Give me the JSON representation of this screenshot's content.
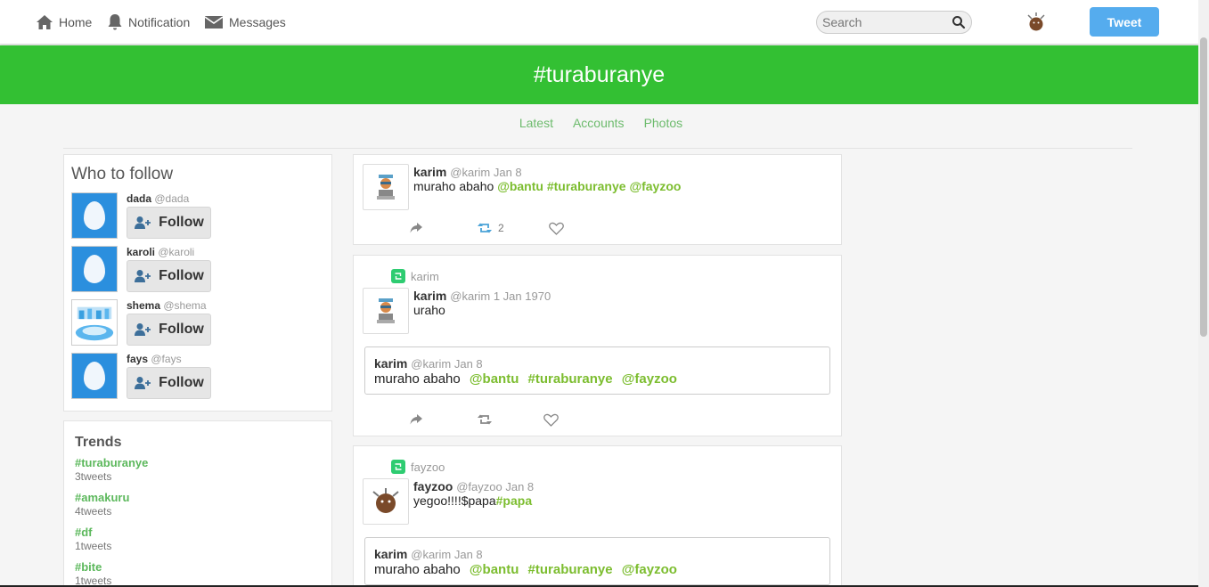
{
  "nav": {
    "home": "Home",
    "notification": "Notification",
    "messages": "Messages",
    "search_placeholder": "Search",
    "tweet_button": "Tweet"
  },
  "banner": {
    "hashtag": "#turaburanye"
  },
  "tabs": [
    "Latest",
    "Accounts",
    "Photos"
  ],
  "who_to_follow": {
    "title": "Who to follow",
    "follow_label": "Follow",
    "users": [
      {
        "name": "dada",
        "handle": "@dada"
      },
      {
        "name": "karoli",
        "handle": "@karoli"
      },
      {
        "name": "shema",
        "handle": "@shema"
      },
      {
        "name": "fays",
        "handle": "@fays"
      }
    ]
  },
  "trends": {
    "title": "Trends",
    "items": [
      {
        "tag": "#turaburanye",
        "count": "3tweets"
      },
      {
        "tag": "#amakuru",
        "count": "4tweets"
      },
      {
        "tag": "#df",
        "count": "1tweets"
      },
      {
        "tag": "#bite",
        "count": "1tweets"
      }
    ]
  },
  "feed": [
    {
      "author": "karim",
      "meta": "@karim Jan 8",
      "text_plain": "muraho abaho",
      "text_tags": [
        "@bantu",
        "#turaburanye",
        "@fayzoo"
      ],
      "retweet_count": "2"
    },
    {
      "retweeted_by": "karim",
      "author": "karim",
      "meta": "@karim 1 Jan 1970",
      "text_plain": "uraho",
      "quote": {
        "author": "karim",
        "meta": "@karim Jan 8",
        "text_plain": "muraho abaho",
        "text_tags": [
          "@bantu",
          "#turaburanye",
          "@fayzoo"
        ]
      }
    },
    {
      "retweeted_by": "fayzoo",
      "author": "fayzoo",
      "meta": "@fayzoo Jan 8",
      "text_plain": "yegoo!!!!$papa",
      "text_tag": "#papa",
      "quote": {
        "author": "karim",
        "meta": "@karim Jan 8",
        "text_plain": "muraho abaho",
        "text_tags": [
          "@bantu",
          "#turaburanye",
          "@fayzoo"
        ]
      }
    }
  ],
  "colors": {
    "banner": "#33c033",
    "tweet_button": "#55acee",
    "tag_green": "#7cbd2f",
    "trend_green": "#5cb85c"
  }
}
